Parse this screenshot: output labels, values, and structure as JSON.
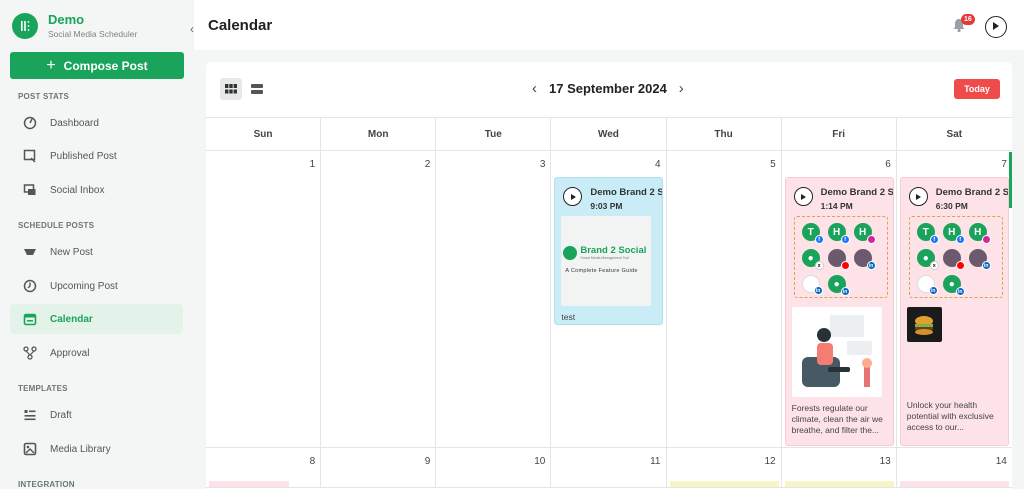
{
  "brand": {
    "name": "Demo",
    "subtitle": "Social Media Scheduler"
  },
  "compose_label": "Compose Post",
  "sections": [
    {
      "title": "POST STATS",
      "items": [
        {
          "label": "Dashboard",
          "icon": "dashboard-icon"
        },
        {
          "label": "Published Post",
          "icon": "published-post-icon"
        },
        {
          "label": "Social Inbox",
          "icon": "social-inbox-icon"
        }
      ]
    },
    {
      "title": "SCHEDULE POSTS",
      "items": [
        {
          "label": "New Post",
          "icon": "new-post-icon"
        },
        {
          "label": "Upcoming Post",
          "icon": "upcoming-post-icon"
        },
        {
          "label": "Calendar",
          "icon": "calendar-icon",
          "active": true
        },
        {
          "label": "Approval",
          "icon": "approval-icon"
        }
      ]
    },
    {
      "title": "TEMPLATES",
      "items": [
        {
          "label": "Draft",
          "icon": "draft-icon"
        },
        {
          "label": "Media Library",
          "icon": "media-library-icon"
        }
      ]
    },
    {
      "title": "INTEGRATION",
      "items": []
    }
  ],
  "header": {
    "title": "Calendar",
    "notification_count": "16"
  },
  "calendar": {
    "current_date": "17 September 2024",
    "today_label": "Today",
    "weekdays": [
      "Sun",
      "Mon",
      "Tue",
      "Wed",
      "Thu",
      "Fri",
      "Sat"
    ],
    "week1": [
      "1",
      "2",
      "3",
      "4",
      "5",
      "6",
      "7"
    ],
    "week2": [
      "8",
      "9",
      "10",
      "11",
      "12",
      "13",
      "14"
    ],
    "events": {
      "wed": {
        "name": "Demo Brand 2 S",
        "time": "9:03 PM",
        "caption": "test",
        "image_title": "Brand 2 Social",
        "image_sub": "Social Media Management Tool",
        "image_tagline": "A Complete Feature Guide"
      },
      "fri": {
        "name": "Demo Brand 2 S",
        "time": "1:14 PM",
        "caption": "Forests regulate our climate, clean the air we breathe, and filter the..."
      },
      "sat": {
        "name": "Demo Brand 2 S",
        "time": "6:30 PM",
        "caption": "Unlock your health potential with exclusive access to our..."
      }
    },
    "account_letters": {
      "t": "T",
      "h": "H"
    }
  },
  "colors": {
    "brand_green": "#1aa35a",
    "today_red": "#ef4b4b",
    "event_blue": "#c9ecf7",
    "event_pink": "#fde3e8"
  }
}
